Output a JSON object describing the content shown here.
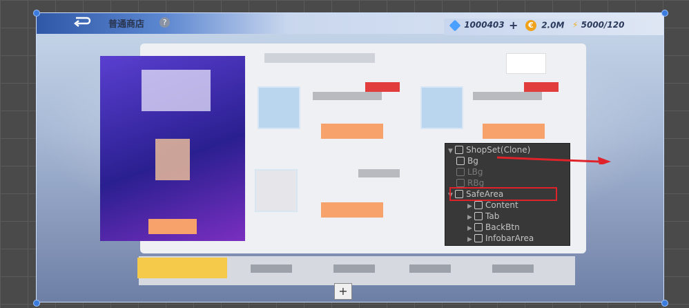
{
  "topbar": {
    "back_icon": "return-arrow-icon",
    "title": "普通商店",
    "help": "?"
  },
  "currency": {
    "gems": "1000403",
    "add": "+",
    "coins": "2.0M",
    "energy": "5000/120",
    "coin_symbol": "€"
  },
  "hierarchy": {
    "nodes": [
      {
        "label": "ShopSet(Clone)",
        "expanded": true
      },
      {
        "label": "Bg"
      },
      {
        "label": "LBg"
      },
      {
        "label": "RBg"
      },
      {
        "label": "SafeArea",
        "expanded": true
      },
      {
        "label": "Content"
      },
      {
        "label": "Tab"
      },
      {
        "label": "BackBtn"
      },
      {
        "label": "InfobarArea"
      }
    ]
  },
  "scene": {
    "add_button": "+"
  },
  "colors": {
    "highlight_box": "#e0232a",
    "arrow": "#e0232a"
  }
}
